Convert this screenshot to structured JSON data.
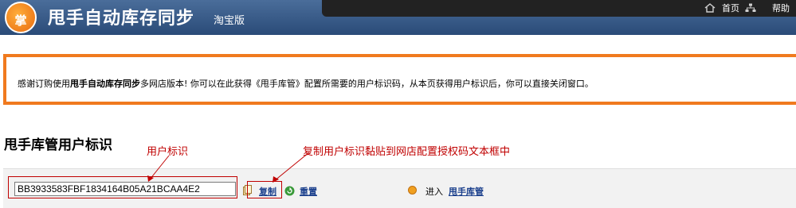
{
  "header": {
    "logo_text": "掌",
    "title": "甩手自动库存同步",
    "subtitle": "淘宝版",
    "nav_home": "首页",
    "nav_help": "帮助"
  },
  "notice": {
    "part1": "感谢订购使用",
    "part2": "甩手自动库存同步",
    "part3": "多网店版本!",
    "part4": " 你可以在此获得《甩手库管》配置所需要的用户标识码，从本页获得用户标识后，你可以直接关闭窗口。"
  },
  "section": {
    "title": "甩手库管用户标识"
  },
  "annotations": {
    "label": "用户标识",
    "hint": "复制用户标识黏贴到网店配置授权码文本框中"
  },
  "panel": {
    "user_id": "BB3933583FBF1834164B05A21BCAA4E2",
    "copy_label": "复制",
    "reset_label": "重置",
    "enter_label": "进入",
    "enter_link": "甩手库管"
  },
  "colors": {
    "header_bg": "#2f5080",
    "notice_border": "#f07a1e",
    "annotation": "#c00000",
    "link": "#1a3f8c"
  }
}
